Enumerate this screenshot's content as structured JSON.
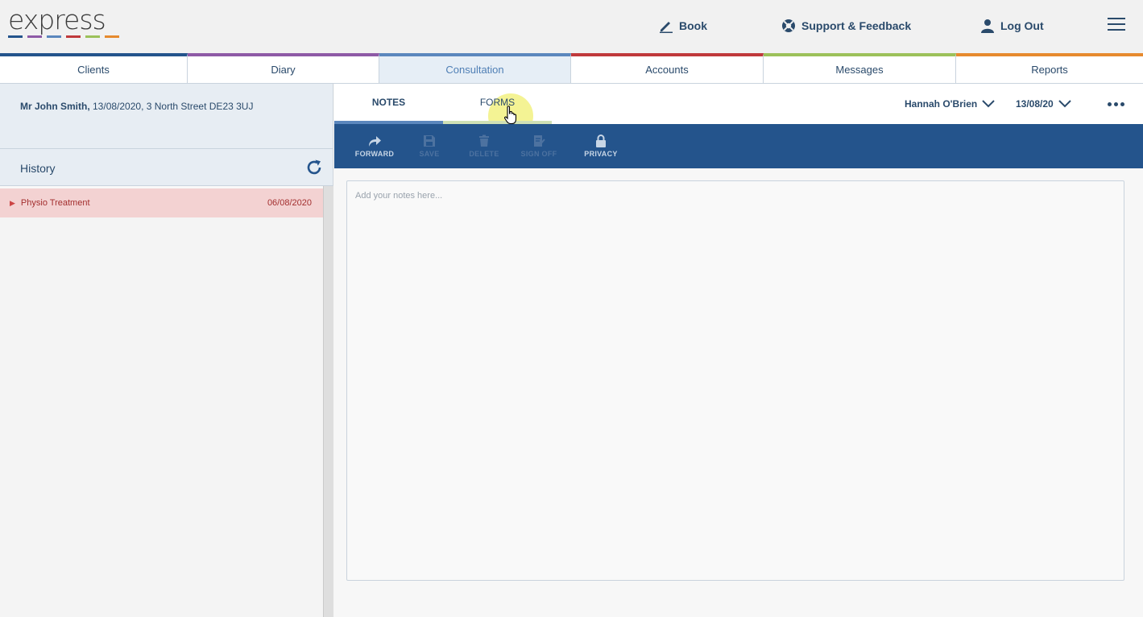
{
  "header": {
    "logo_text": "express",
    "logo_colors": [
      "#24548c",
      "#8e5aa6",
      "#5b87bd",
      "#c0393b",
      "#9cc15a",
      "#e68a2e"
    ],
    "book_label": "Book",
    "support_label": "Support & Feedback",
    "logout_label": "Log Out",
    "icons": {
      "book": "pencil-icon",
      "support": "lifebuoy-icon",
      "logout": "user-icon",
      "menu": "hamburger-menu-icon"
    }
  },
  "nav": {
    "tabs": [
      {
        "label": "Clients",
        "color": "#24548c"
      },
      {
        "label": "Diary",
        "color": "#8e5aa6"
      },
      {
        "label": "Consultation",
        "color": "#5b87bd",
        "active": true
      },
      {
        "label": "Accounts",
        "color": "#c0393b"
      },
      {
        "label": "Messages",
        "color": "#9cc15a"
      },
      {
        "label": "Reports",
        "color": "#e68a2e"
      }
    ]
  },
  "client": {
    "name": "Mr John Smith,",
    "details": " 13/08/2020, 3 North Street DE23 3UJ"
  },
  "history": {
    "title": "History",
    "items": [
      {
        "label": "Physio Treatment",
        "date": "06/08/2020"
      }
    ]
  },
  "subtabs": {
    "notes_label": "NOTES",
    "forms_label": "FORMS",
    "practitioner": "Hannah O'Brien",
    "date": "13/08/20"
  },
  "toolbar": {
    "forward": "FORWARD",
    "save": "SAVE",
    "delete": "DELETE",
    "sign_off": "SIGN OFF",
    "privacy": "PRIVACY"
  },
  "notes": {
    "placeholder": "Add your notes here..."
  }
}
